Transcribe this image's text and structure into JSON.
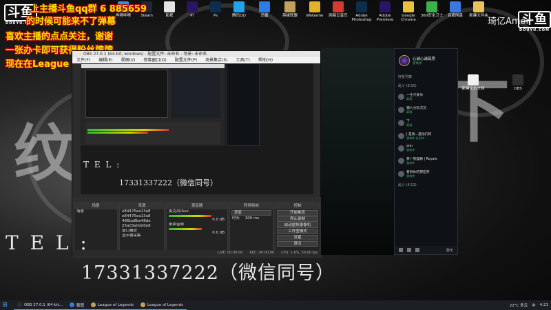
{
  "overlay": {
    "line1": "上主播斗鱼qq群 6 885659",
    "line2": "的时候可能来不了弹幕",
    "line3": "喜欢主播的点点关注，谢谢",
    "line4": "一张办卡即可获得粉丝牌牌",
    "line5": "现在在League",
    "tel_label": "T E L :",
    "phone": "17331337222（微信同号）",
    "inner_tel_label": "T E L :",
    "inner_phone": "17331337222（微信同号）",
    "deco_glyph_left": "纹",
    "deco_glyph_right": "下"
  },
  "logos": {
    "topleft_main": "斗鱼",
    "topleft_sub": "DOUYU.COM",
    "topright_main": "斗鱼",
    "topright_sub": "DOUYU.COM",
    "watermark": "琦亿Amor"
  },
  "desktop_icons": [
    {
      "label": "哔哩哔哩",
      "color": "#3a8fd6"
    },
    {
      "label": "Steam",
      "color": "#1b2838"
    },
    {
      "label": "影视",
      "color": "#e4e4e4"
    },
    {
      "label": "Pr",
      "color": "#2a1466"
    },
    {
      "label": "Ps",
      "color": "#0d2d4d"
    },
    {
      "label": "腾讯QQ",
      "color": "#22a3e8"
    },
    {
      "label": "迅雷",
      "color": "#2d7be5"
    },
    {
      "label": "英雄联盟",
      "color": "#c3a15c"
    },
    {
      "label": "WeGame",
      "color": "#e2b22a"
    },
    {
      "label": "网易云音乐",
      "color": "#d33a31"
    },
    {
      "label": "Adobe Photoshop",
      "color": "#0d2d4d"
    },
    {
      "label": "Adobe Premiere",
      "color": "#2a1466"
    },
    {
      "label": "Google Chrome",
      "color": "#e8c23a"
    },
    {
      "label": "360安全卫士",
      "color": "#3cb049"
    },
    {
      "label": "百度网盘",
      "color": "#3a78e0"
    },
    {
      "label": "新建文件夹",
      "color": "#e8c25a"
    },
    {
      "label": "新建文本文档",
      "color": "#f0f0f0"
    },
    {
      "label": "OBS",
      "color": "#303030"
    }
  ],
  "obs": {
    "title": "OBS 27.0.1 (64-bit, windows) - 配置文件: 未命名 - 场景: 未命名",
    "menu": [
      "文件(F)",
      "编辑(E)",
      "视图(V)",
      "停靠窗口(D)",
      "配置文件(P)",
      "场景集合(S)",
      "工具(T)",
      "帮助(H)"
    ],
    "dock_titles": [
      "场景",
      "来源",
      "混音器",
      "转场特效",
      "控制"
    ],
    "scene_item": "场景",
    "sources": [
      "e84475ea13a8",
      "e84475ea13a8",
      "486ba8be48de",
      "25a03a0dd0e8",
      "窗口捕获",
      "显示器采集"
    ],
    "mixer": [
      {
        "name": "麦克风/Aux",
        "level": "0.0 dB"
      },
      {
        "name": "桌面音频",
        "level": "0.0 dB"
      }
    ],
    "transition": "渐变",
    "transition_duration_label": "时长",
    "transition_duration": "300 ms",
    "controls": [
      "开始推流",
      "停止录制",
      "启动虚拟摄像机",
      "工作室模式",
      "设置",
      "退出"
    ],
    "status": {
      "live": "LIVE: 00:00:00",
      "rec": "REC: 00:00:00",
      "cpu": "CPU: 1.6%, 30.00 fps"
    }
  },
  "friends": {
    "self_name": "心诚心诚琉思",
    "self_status": "游戏中",
    "section_title": "好友列表",
    "group_label": "乱斗 (8/15)",
    "group2_label": "乱斗 (4/12)",
    "items": [
      {
        "name": "一生只爱你",
        "status": "离线"
      },
      {
        "name": "钢六分队沉沉",
        "status": "离线"
      },
      {
        "name": "下",
        "status": "离线"
      },
      {
        "name": "J 是我...是他们的",
        "status": "游戏中 队列中 ..."
      },
      {
        "name": "afei",
        "status": "游戏中"
      },
      {
        "name": "萝卜熊猫精 | Royale",
        "status": "游戏中"
      },
      {
        "name": "看到你的那些笑",
        "status": "游戏中"
      }
    ],
    "footer_label": "聊天"
  },
  "taskbar": {
    "start": "⊞",
    "items": [
      {
        "label": "OBS 27.0.1 (64-bit...",
        "color": "#2f2f2f"
      },
      {
        "label": "截图",
        "color": "#3a7bd5"
      },
      {
        "label": "League of Legends",
        "color": "#c3a15c"
      },
      {
        "label": "League of Legends",
        "color": "#c3a15c"
      }
    ],
    "weather": "22°C 多云",
    "lang": "中",
    "time": "4:21"
  }
}
